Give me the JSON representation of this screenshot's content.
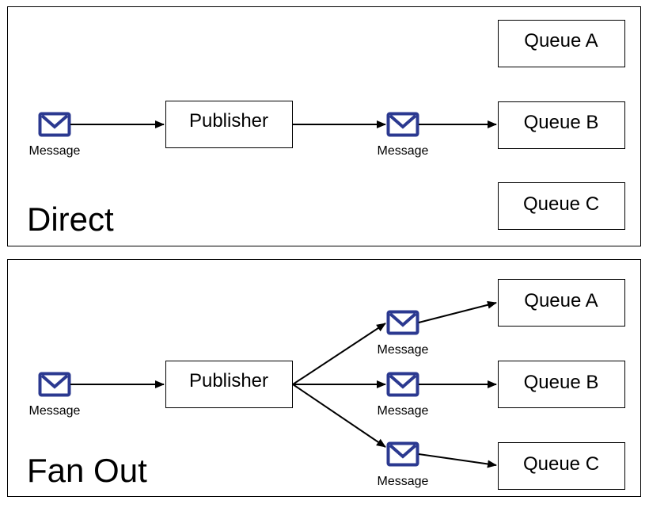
{
  "colors": {
    "envelope": "#2b3990",
    "line": "#000000"
  },
  "icons": {
    "message": "envelope-icon"
  },
  "panels": [
    {
      "title": "Direct",
      "publisher": "Publisher",
      "queues": [
        "Queue A",
        "Queue B",
        "Queue C"
      ],
      "messages": [
        "Message",
        "Message"
      ]
    },
    {
      "title": "Fan Out",
      "publisher": "Publisher",
      "queues": [
        "Queue A",
        "Queue B",
        "Queue C"
      ],
      "messages": [
        "Message",
        "Message",
        "Message",
        "Message"
      ]
    }
  ]
}
